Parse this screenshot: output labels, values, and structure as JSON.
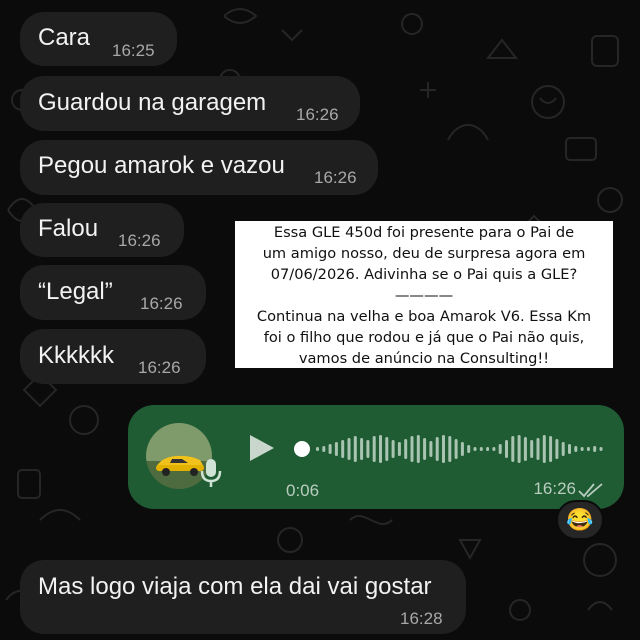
{
  "chat": {
    "incoming": [
      {
        "text": "Cara",
        "time": "16:25"
      },
      {
        "text": "Guardou na garagem",
        "time": "16:26"
      },
      {
        "text": "Pegou amarok e vazou",
        "time": "16:26"
      },
      {
        "text": "Falou",
        "time": "16:26"
      },
      {
        "text": "“Legal”",
        "time": "16:26"
      },
      {
        "text": "Kkkkkk",
        "time": "16:26"
      }
    ],
    "last_message": {
      "text": "Mas logo viaja com ela dai vai gostar",
      "time": "16:28"
    }
  },
  "overlay_note": {
    "lines": [
      "Essa GLE 450d foi presente para o Pai de",
      "um amigo nosso, deu de surpresa agora em",
      "07/06/2026. Adivinha se o Pai quis a GLE?",
      "————",
      "Continua na velha e boa Amarok V6. Essa Km",
      "foi o filho que rodou e já que o Pai não quis,",
      "vamos de anúncio na Consulting!!"
    ]
  },
  "voice_message": {
    "duration": "0:06",
    "time": "16:26",
    "status_icon": "double-check-icon",
    "play_icon": "play-icon",
    "mic_icon": "microphone-icon",
    "avatar_icon": "avatar-yellow-car"
  },
  "reaction": {
    "emoji": "😂"
  },
  "colors": {
    "background": "#0b0b0b",
    "incoming_bubble": "#1f1f1f",
    "outgoing_bubble": "#1f5c33",
    "timestamp": "#a8a8a8"
  }
}
